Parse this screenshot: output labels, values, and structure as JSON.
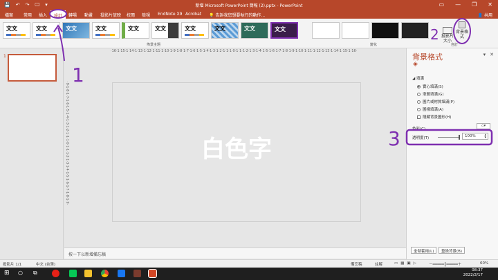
{
  "title_bar": {
    "document_title": "新增 Microsoft PowerPoint 簡報 (2).pptx - PowerPoint",
    "qat": [
      "💾",
      "↶",
      "↷",
      "🖵",
      "▾"
    ],
    "window_buttons": [
      "▭",
      "—",
      "❐",
      "✕"
    ]
  },
  "ribbon_tabs": [
    "檔案",
    "常用",
    "插入",
    "設計",
    "轉場",
    "動畫",
    "投影片放映",
    "校閱",
    "檢視",
    "EndNote X9",
    "Acrobat"
  ],
  "active_tab": "設計",
  "search": "告訴我您想要執行的動作...",
  "share": "共用",
  "ribbon": {
    "themes_caption": "佈景主題",
    "theme_sample": "文文",
    "variants_caption": "變化",
    "custom_caption": "自訂",
    "slide_size": "投影片大小",
    "format_background": "背景格式"
  },
  "thumbnail": {
    "number": "1"
  },
  "ruler_h": "·16·1·15·1·14·1·13·1·12·1·11·1·10·1·9·1·8·1·7·1·6·1·5·1·4·1·3·1·2·1·1·1·0·1·1·1·2·1·3·1·4·1·5·1·6·1·7·1·8·1·9·1·10·1·11·1·12·1·13·1·14·1·15·1·16·",
  "ruler_v": "·9·1·8·1·7·1·6·1·5·1·4·1·3·1·2·1·1·1·0·1·1·1·2·1·3·1·4·1·5·1·6·1·7·1·8·1·9·",
  "slide": {
    "text": "白色字"
  },
  "notes_placeholder": "按一下以新增備忘稿",
  "format_pane": {
    "title": "背景格式",
    "section": "填滿",
    "options": [
      {
        "label": "實心填滿(S)",
        "type": "radio",
        "checked": true
      },
      {
        "label": "漸層填滿(G)",
        "type": "radio",
        "checked": false
      },
      {
        "label": "圖片或材質填滿(P)",
        "type": "radio",
        "checked": false
      },
      {
        "label": "圖樣填滿(A)",
        "type": "radio",
        "checked": false
      },
      {
        "label": "隱藏背景圖形(H)",
        "type": "checkbox",
        "checked": false
      }
    ],
    "color_label": "色彩(C)",
    "transparency_label": "透明度(T)",
    "transparency_value": "100%",
    "apply_all": "全部套用(L)",
    "reset": "重設背景(B)"
  },
  "status_bar": {
    "slide_info": "投影片 1/1",
    "language": "中文 (台灣)",
    "notes": "備忘稿",
    "comments": "註解",
    "zoom": "60%"
  },
  "taskbar": {
    "time": "08:37",
    "date": "2022/2/17"
  },
  "annotations": {
    "one": "1",
    "two": "2",
    "three": "3",
    "color": "#7e2fb0"
  }
}
